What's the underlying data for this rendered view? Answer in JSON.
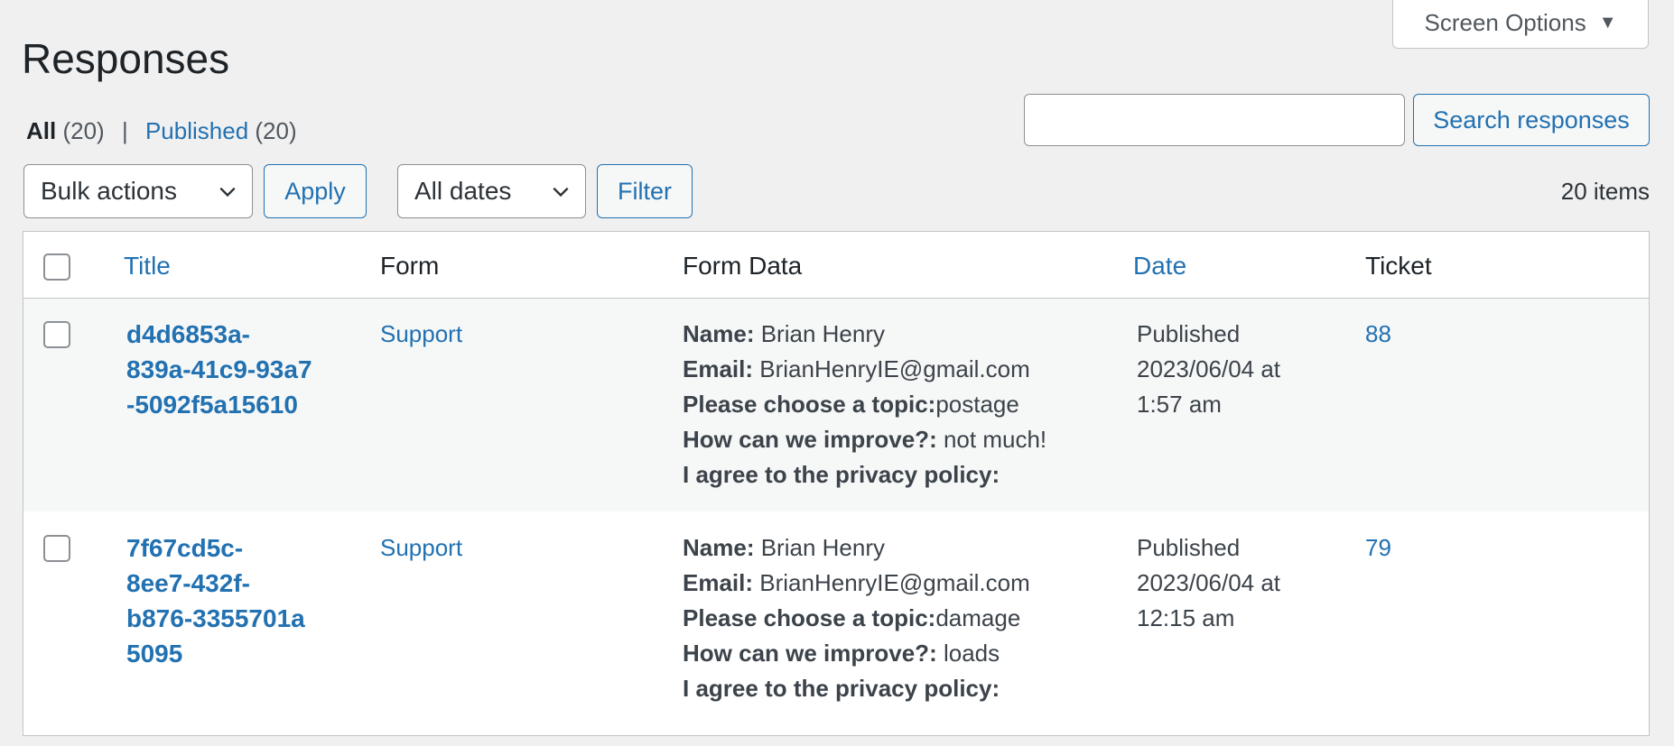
{
  "screen_options": {
    "label": "Screen Options",
    "arrow": "▼"
  },
  "page_title": "Responses",
  "views": {
    "all_label": "All",
    "all_count": "(20)",
    "separator": "|",
    "published_label": "Published",
    "published_count": "(20)"
  },
  "search": {
    "value": "",
    "button_label": "Search responses"
  },
  "bulk_actions": {
    "selected": "Bulk actions",
    "apply_label": "Apply"
  },
  "date_filter": {
    "selected": "All dates",
    "filter_label": "Filter"
  },
  "items_count": "20 items",
  "table": {
    "headers": {
      "title": "Title",
      "form": "Form",
      "form_data": "Form Data",
      "date": "Date",
      "ticket": "Ticket"
    },
    "rows": [
      {
        "title_lines": [
          "d4d6853a-",
          "839a-41c9-93a7",
          "-5092f5a15610"
        ],
        "form": "Support",
        "form_data": [
          {
            "label": "Name:",
            "value": " Brian Henry"
          },
          {
            "label": "Email:",
            "value": " BrianHenryIE@gmail.com"
          },
          {
            "label": "Please choose a topic:",
            "value": "postage"
          },
          {
            "label": "How can we improve?:",
            "value": " not much!"
          },
          {
            "label": "I agree to the privacy policy:",
            "value": ""
          }
        ],
        "date_lines": [
          "Published",
          "2023/06/04 at",
          "1:57 am"
        ],
        "ticket": "88"
      },
      {
        "title_lines": [
          "7f67cd5c-",
          "8ee7-432f-",
          "b876-3355701a",
          "5095"
        ],
        "form": "Support",
        "form_data": [
          {
            "label": "Name:",
            "value": " Brian Henry"
          },
          {
            "label": "Email:",
            "value": " BrianHenryIE@gmail.com"
          },
          {
            "label": "Please choose a topic:",
            "value": "damage"
          },
          {
            "label": "How can we improve?:",
            "value": " loads"
          },
          {
            "label": "I agree to the privacy policy:",
            "value": ""
          }
        ],
        "date_lines": [
          "Published",
          "2023/06/04 at",
          "12:15 am"
        ],
        "ticket": "79"
      }
    ]
  }
}
